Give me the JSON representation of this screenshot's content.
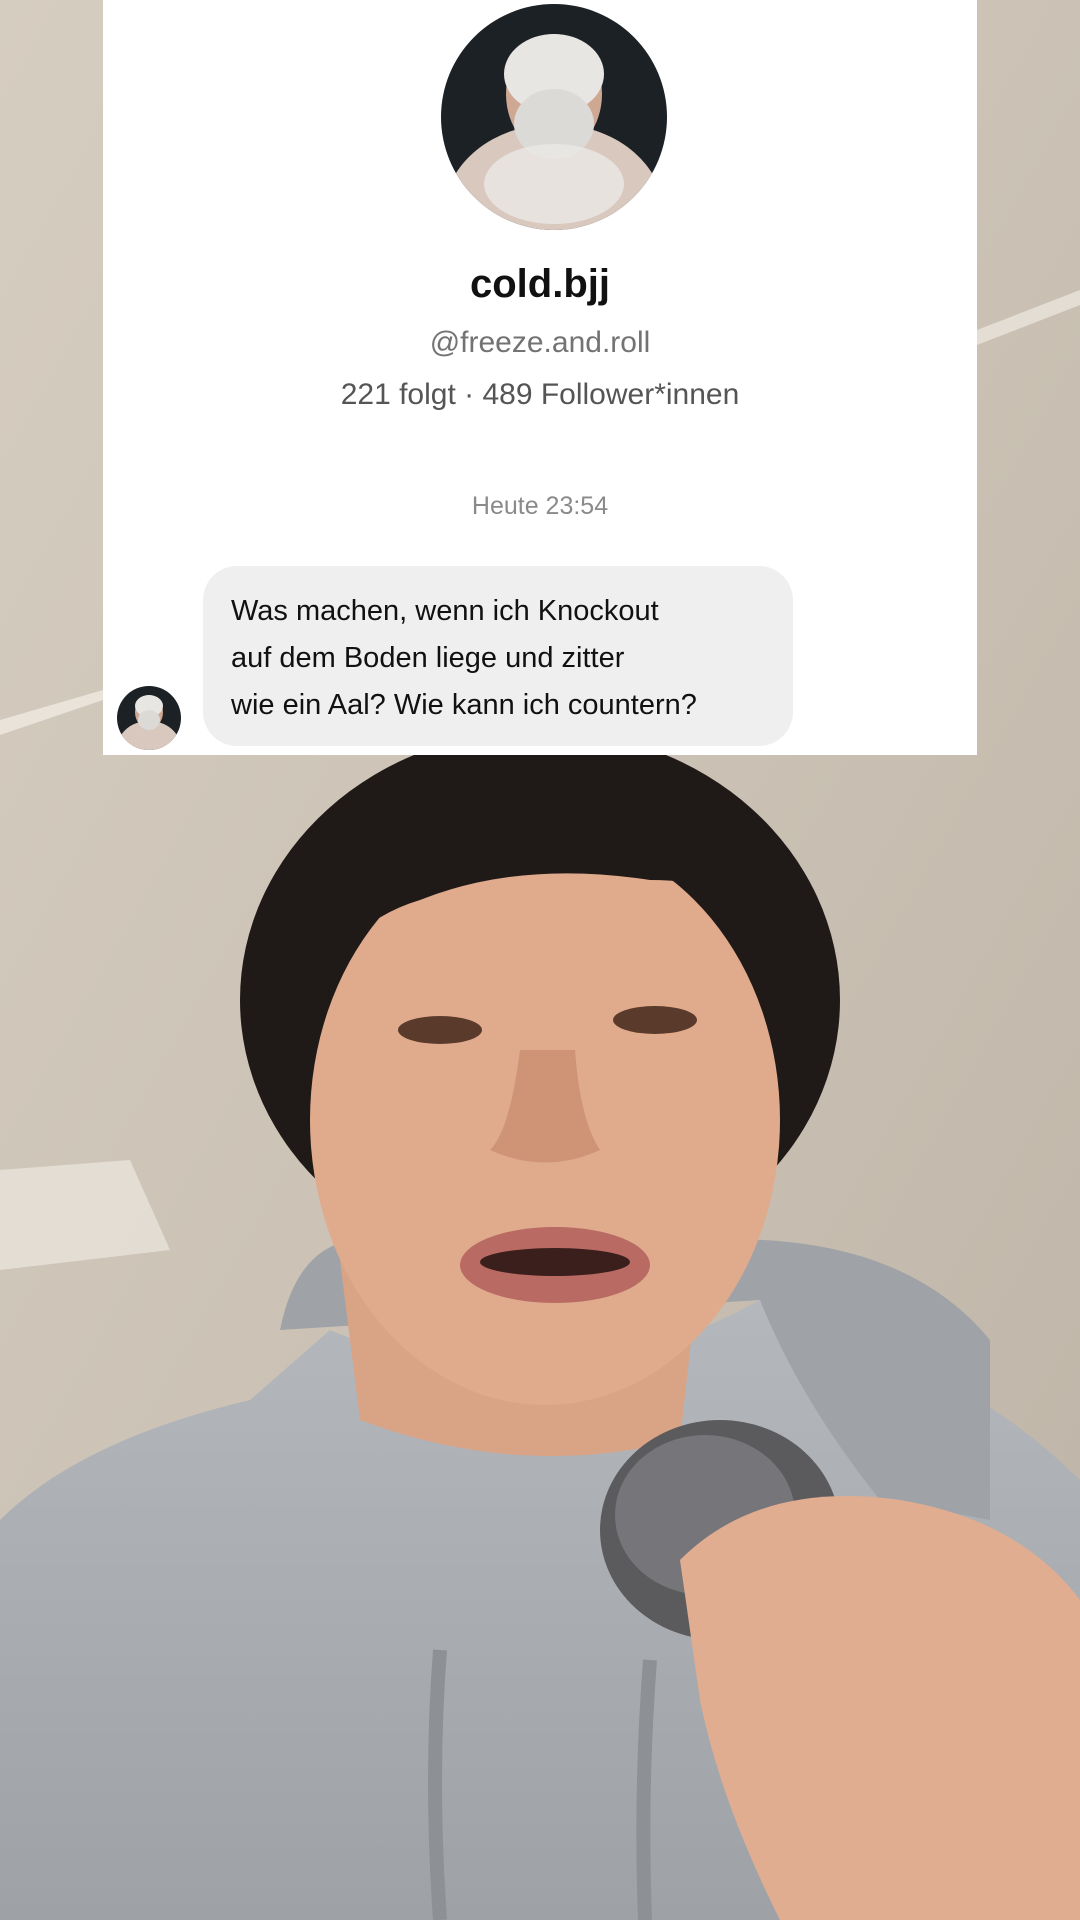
{
  "profile": {
    "name": "cold.bjj",
    "handle": "@freeze.and.roll",
    "stats": "221 folgt · 489 Follower*innen",
    "avatar_icon": "profile-photo-icon"
  },
  "conversation": {
    "timestamp": "Heute 23:54",
    "message": {
      "lines": [
        "Was machen, wenn ich Knockout",
        "auf dem Boden liege und zitter",
        "wie ein Aal? Wie kann ich countern?"
      ]
    }
  },
  "colors": {
    "card_background": "#ffffff",
    "bubble_background": "#efefef",
    "secondary_text": "#737373",
    "hoodie": "#a9adb1"
  }
}
